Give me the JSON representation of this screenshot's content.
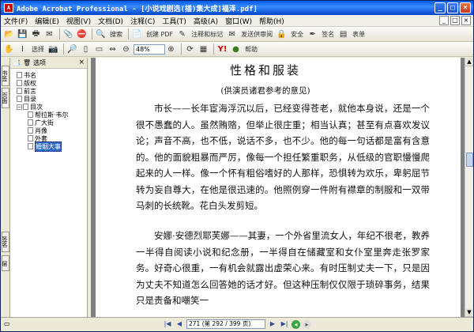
{
  "window": {
    "title": "Adobe Acrobat Professional - [小说戏剧选(插)集大成]福泽.pdf]"
  },
  "menu": [
    "文件(F)",
    "编辑(E)",
    "视图(V)",
    "文档(D)",
    "注释(C)",
    "工具(T)",
    "高级(A)",
    "窗口(W)",
    "帮助(H)"
  ],
  "toolbar1": {
    "create_pdf": "创建 PDF",
    "comment": "注释和标记",
    "send_review": "发送供审阅",
    "secure": "安全",
    "sign": "签名",
    "forms": "表单",
    "search": "搜索"
  },
  "toolbar2": {
    "select": "选择",
    "zoom": "48%",
    "help": "帮助"
  },
  "side_tabs": {
    "bookmarks": "书签",
    "pages": "页面",
    "signatures": "签名",
    "layers": "层"
  },
  "bookmarks": {
    "options": "选项",
    "items": [
      {
        "label": "书名",
        "level": 1
      },
      {
        "label": "版权",
        "level": 1
      },
      {
        "label": "前言",
        "level": 1
      },
      {
        "label": "目录",
        "level": 1
      },
      {
        "label": "目次",
        "level": 1,
        "expanded": true
      },
      {
        "label": "帮拉斯·韦尔",
        "level": 2
      },
      {
        "label": "广大街",
        "level": 2
      },
      {
        "label": "肖像",
        "level": 2
      },
      {
        "label": "外套",
        "level": 2
      },
      {
        "label": "婚姻大事",
        "level": 2,
        "selected": true
      }
    ]
  },
  "page": {
    "title": "性格和服装",
    "subtitle": "(供演员诸君参考的意见)",
    "paragraphs": [
      "市长——长年宦海浮沉以后，已经变得苍老，就他本身说，还是一个很不愚蠢的人。虽然贿赂，但举止很庄重；相当认真；甚至有点喜欢发议论；声音不高，也不低，说话不多，也不少。他的每一句话都是富有含意的。他的面貌粗暴而严厉，像每一个担任繁重职务，从低级的官职慢慢爬起来的人一样。像一个怀有粗俗嗜好的人那样，恐惧转为欢乐，卑躬屈节转为妄自尊大，在他是很迅速的。他照例穿一件附有襟章的制服和一双带马刺的长统靴。花白头发剪短。",
      "安娜·安德烈耶芙娜——其妻，一个外省里流女人，年纪不很老，教养一半得自阅读小说和纪念册，一半得自在储藏室和女仆室里奔走张罗家务。好奇心很重，一有机会就露出虚荣心来。有时压制丈夫一下，只是因为丈夫不知道怎么回答她的话才好。但这种压制仅仅限于琐碎事务，结果只是责备和嘲笑一"
    ]
  },
  "status": {
    "page_indicator": "271 (第 292 / 399 页)"
  }
}
